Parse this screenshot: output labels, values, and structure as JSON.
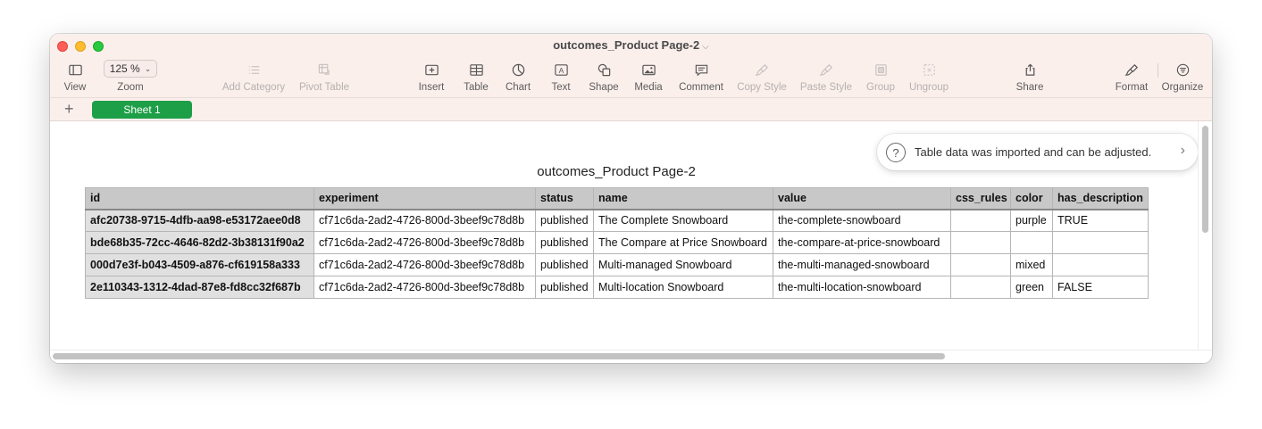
{
  "window": {
    "title": "outcomes_Product Page-2"
  },
  "toolbar": {
    "view_label": "View",
    "zoom_value": "125 %",
    "zoom_label": "Zoom",
    "add_category_label": "Add Category",
    "pivot_table_label": "Pivot Table",
    "insert_label": "Insert",
    "table_label": "Table",
    "chart_label": "Chart",
    "text_label": "Text",
    "shape_label": "Shape",
    "media_label": "Media",
    "comment_label": "Comment",
    "copy_style_label": "Copy Style",
    "paste_style_label": "Paste Style",
    "group_label": "Group",
    "ungroup_label": "Ungroup",
    "share_label": "Share",
    "format_label": "Format",
    "organize_label": "Organize"
  },
  "sheets": {
    "add_label": "+",
    "active": "Sheet 1"
  },
  "banner": {
    "icon": "?",
    "message": "Table data was imported and can be adjusted.",
    "arrow": "›"
  },
  "table": {
    "title": "outcomes_Product Page-2",
    "headers": [
      "id",
      "experiment",
      "status",
      "name",
      "value",
      "css_rules",
      "color",
      "has_description"
    ],
    "rows": [
      [
        "afc20738-9715-4dfb-aa98-e53172aee0d8",
        "cf71c6da-2ad2-4726-800d-3beef9c78d8b",
        "published",
        "The Complete Snowboard",
        "the-complete-snowboard",
        "",
        "purple",
        "TRUE"
      ],
      [
        "bde68b35-72cc-4646-82d2-3b38131f90a2",
        "cf71c6da-2ad2-4726-800d-3beef9c78d8b",
        "published",
        "The Compare at Price Snowboard",
        "the-compare-at-price-snowboard",
        "",
        "",
        ""
      ],
      [
        "000d7e3f-b043-4509-a876-cf619158a333",
        "cf71c6da-2ad2-4726-800d-3beef9c78d8b",
        "published",
        "Multi-managed Snowboard",
        "the-multi-managed-snowboard",
        "",
        "mixed",
        ""
      ],
      [
        "2e110343-1312-4dad-87e8-fd8cc32f687b",
        "cf71c6da-2ad2-4726-800d-3beef9c78d8b",
        "published",
        "Multi-location Snowboard",
        "the-multi-location-snowboard",
        "",
        "green",
        "FALSE"
      ]
    ]
  },
  "colors": {
    "titlebar": "#fbefec",
    "sheet_tab": "#1d9f48",
    "header_fill": "#c8c8c8",
    "id_column_fill": "#e0e0e0"
  },
  "icons": {
    "view": "sidebar-icon",
    "add_category": "list-icon",
    "pivot_table": "pivot-table-icon",
    "insert": "plus-square-icon",
    "table": "table-grid-icon",
    "chart": "pie-chart-icon",
    "text": "text-box-icon",
    "shape": "shape-icon",
    "media": "image-icon",
    "comment": "comment-bubble-icon",
    "copy_style": "paintbrush-icon",
    "paste_style": "paintbrush-icon",
    "group": "group-icon",
    "ungroup": "ungroup-icon",
    "share": "share-icon",
    "format": "paintbrush-icon",
    "organize": "organize-filter-icon"
  }
}
